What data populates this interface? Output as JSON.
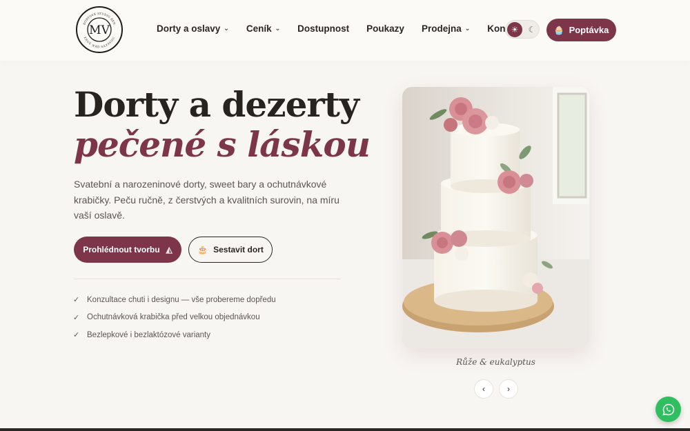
{
  "logo": {
    "monogram": "MV",
    "ring_top": "DORTOVÉ STUDIO BEN",
    "ring_bottom": "ZRUČ NAD SÁZAVOU"
  },
  "nav": {
    "items": [
      {
        "label": "Dorty a oslavy",
        "has_dropdown": true
      },
      {
        "label": "Ceník",
        "has_dropdown": true
      },
      {
        "label": "Dostupnost",
        "has_dropdown": false
      },
      {
        "label": "Poukazy",
        "has_dropdown": false
      },
      {
        "label": "Prodejna",
        "has_dropdown": true
      },
      {
        "label": "Kontakt",
        "has_dropdown": false
      }
    ],
    "theme_toggle": {
      "active": "light",
      "light_icon": "sun-icon",
      "dark_icon": "moon-icon"
    },
    "cta_label": "Poptávka",
    "cta_icon": "cupcake-icon"
  },
  "hero": {
    "title_line1": "Dorty a dezerty",
    "title_line2": "pečené s láskou",
    "lead": "Svatební a narozeninové dorty, sweet bary a ochutnávkové krabičky. Peču ručně, z čerstvých a kvalitních surovin, na míru vaší oslavě.",
    "primary_button": "Prohlédnout tvorbu",
    "primary_icon": "cake-slice-icon",
    "secondary_button": "Sestavit dort",
    "secondary_icon": "tiered-cake-icon",
    "features": [
      "Konzultace chuti i designu — vše probereme dopředu",
      "Ochutnávková krabička před velkou objednávkou",
      "Bezlepkové i bezlaktózové varianty"
    ]
  },
  "gallery": {
    "caption": "Růže & eukalyptus",
    "prev_icon": "chevron-left-icon",
    "next_icon": "chevron-right-icon"
  },
  "floating": {
    "whatsapp_icon": "whatsapp-icon"
  },
  "colors": {
    "accent": "#7d3549",
    "background": "#f8f6f2",
    "text": "#2a2623",
    "whatsapp": "#2fbf61"
  }
}
